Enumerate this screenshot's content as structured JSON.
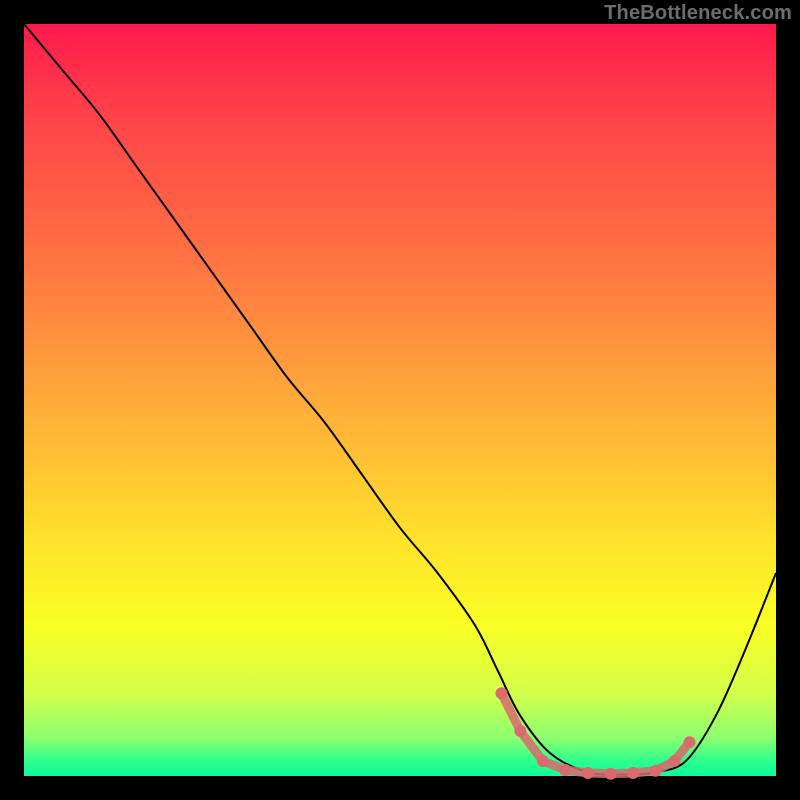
{
  "watermark": "TheBottleneck.com",
  "chart_data": {
    "type": "line",
    "title": "",
    "xlabel": "",
    "ylabel": "",
    "xlim": [
      0,
      100
    ],
    "ylim": [
      0,
      100
    ],
    "grid": false,
    "legend": false,
    "background_gradient": {
      "direction": "vertical",
      "stops": [
        {
          "pos": 0,
          "color": "#ff1a4d"
        },
        {
          "pos": 28,
          "color": "#ff6a44"
        },
        {
          "pos": 55,
          "color": "#ffb936"
        },
        {
          "pos": 80,
          "color": "#f9ff24"
        },
        {
          "pos": 95,
          "color": "#8bff70"
        },
        {
          "pos": 100,
          "color": "#0aff9a"
        }
      ]
    },
    "series": [
      {
        "name": "bottleneck-curve",
        "color": "#000000",
        "x": [
          0,
          5,
          10,
          15,
          20,
          25,
          30,
          35,
          40,
          45,
          50,
          55,
          60,
          63,
          66,
          70,
          75,
          80,
          84,
          88,
          92,
          96,
          100
        ],
        "y": [
          100,
          94,
          88,
          81,
          74,
          67,
          60,
          53,
          47,
          40,
          33,
          27,
          20,
          14,
          8,
          3,
          0.5,
          0.2,
          0.5,
          2,
          8,
          17,
          27
        ]
      },
      {
        "name": "highlight-dots",
        "color": "#d96a6d",
        "type": "scatter",
        "x": [
          63.5,
          66,
          69,
          72,
          75,
          78,
          81,
          84,
          86.5,
          88.5
        ],
        "y": [
          11,
          6,
          2,
          0.8,
          0.4,
          0.3,
          0.4,
          0.7,
          2,
          4.5
        ]
      }
    ]
  }
}
